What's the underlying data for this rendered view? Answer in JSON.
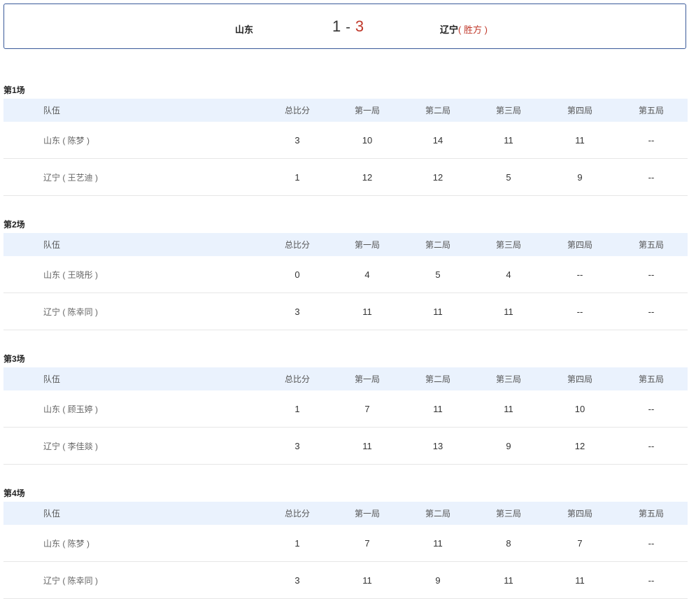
{
  "summary": {
    "team_left": "山东",
    "score_left": "1",
    "score_sep": "-",
    "score_right": "3",
    "team_right": "辽宁",
    "winner_tag": "( 胜方 )"
  },
  "headers": [
    "队伍",
    "总比分",
    "第一局",
    "第二局",
    "第三局",
    "第四局",
    "第五局"
  ],
  "matches": [
    {
      "title": "第1场",
      "rows": [
        {
          "team": "山东 ( 陈梦 )",
          "cells": [
            "3",
            "10",
            "14",
            "11",
            "11",
            "--"
          ]
        },
        {
          "team": "辽宁 ( 王艺迪 )",
          "cells": [
            "1",
            "12",
            "12",
            "5",
            "9",
            "--"
          ]
        }
      ]
    },
    {
      "title": "第2场",
      "rows": [
        {
          "team": "山东 ( 王晓彤 )",
          "cells": [
            "0",
            "4",
            "5",
            "4",
            "--",
            "--"
          ]
        },
        {
          "team": "辽宁 ( 陈幸同 )",
          "cells": [
            "3",
            "11",
            "11",
            "11",
            "--",
            "--"
          ]
        }
      ]
    },
    {
      "title": "第3场",
      "rows": [
        {
          "team": "山东 ( 顾玉婷 )",
          "cells": [
            "1",
            "7",
            "11",
            "11",
            "10",
            "--"
          ]
        },
        {
          "team": "辽宁 ( 李佳燚 )",
          "cells": [
            "3",
            "11",
            "13",
            "9",
            "12",
            "--"
          ]
        }
      ]
    },
    {
      "title": "第4场",
      "rows": [
        {
          "team": "山东 ( 陈梦 )",
          "cells": [
            "1",
            "7",
            "11",
            "8",
            "7",
            "--"
          ]
        },
        {
          "team": "辽宁 ( 陈幸同 )",
          "cells": [
            "3",
            "11",
            "9",
            "11",
            "11",
            "--"
          ]
        }
      ]
    }
  ]
}
